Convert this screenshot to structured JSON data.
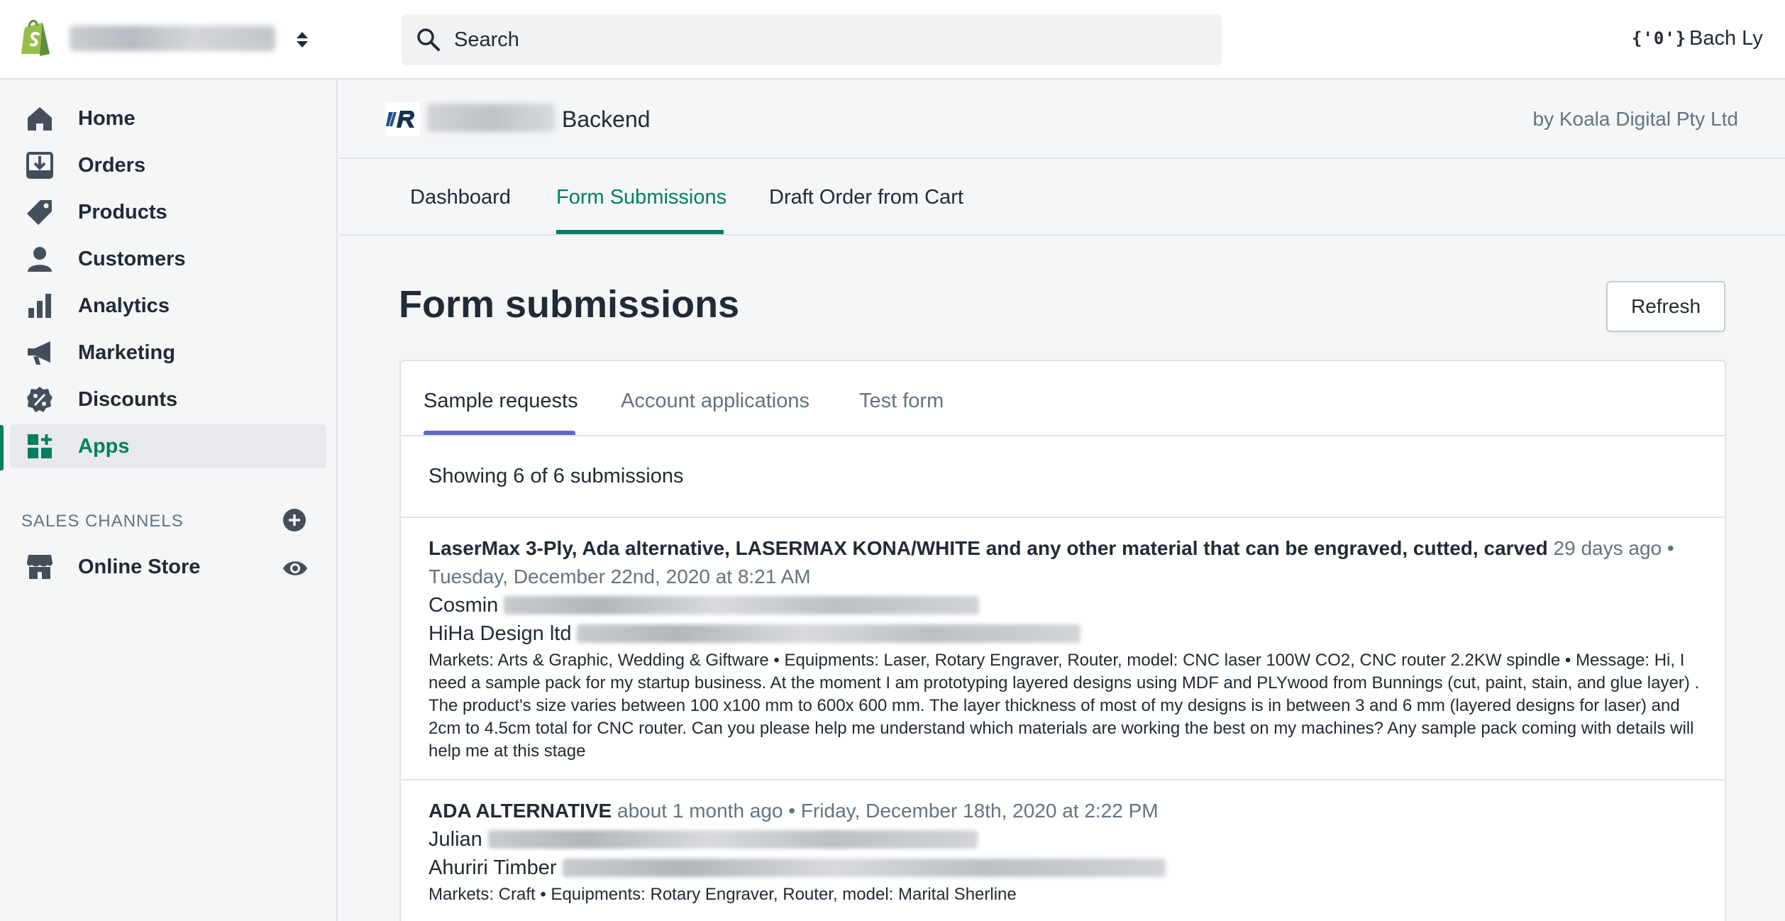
{
  "topbar": {
    "search_placeholder": "Search",
    "user_initials": "{'0'}",
    "user_name": "Bach Ly"
  },
  "sidebar": {
    "items": [
      {
        "label": "Home",
        "icon": "home-icon"
      },
      {
        "label": "Orders",
        "icon": "orders-icon"
      },
      {
        "label": "Products",
        "icon": "tag-icon"
      },
      {
        "label": "Customers",
        "icon": "person-icon"
      },
      {
        "label": "Analytics",
        "icon": "bar-chart-icon"
      },
      {
        "label": "Marketing",
        "icon": "megaphone-icon"
      },
      {
        "label": "Discounts",
        "icon": "discount-icon"
      },
      {
        "label": "Apps",
        "icon": "apps-icon"
      }
    ],
    "sales_channels_title": "SALES CHANNELS",
    "online_store_label": "Online Store"
  },
  "app_header": {
    "title": "Backend",
    "by": "by Koala Digital Pty Ltd"
  },
  "top_tabs": [
    "Dashboard",
    "Form Submissions",
    "Draft Order from Cart"
  ],
  "page": {
    "title": "Form submissions",
    "refresh_label": "Refresh"
  },
  "card": {
    "tabs": [
      "Sample requests",
      "Account applications",
      "Test form"
    ],
    "showing": "Showing 6 of 6 submissions"
  },
  "submissions": [
    {
      "title": "LaserMax 3-Ply, Ada alternative, LASERMAX KONA/WHITE and any other material that can be engraved, cutted, carved",
      "meta": "29 days ago • Tuesday, December 22nd, 2020 at 8:21 AM",
      "name": "Cosmin",
      "company": "HiHa Design ltd",
      "details": "Markets: Arts & Graphic, Wedding & Giftware • Equipments: Laser, Rotary Engraver, Router, model: CNC laser 100W CO2, CNC router 2.2KW spindle • Message: Hi, I need a sample pack for my startup business. At the moment I am prototyping layered designs using MDF and PLYwood from Bunnings (cut, paint, stain, and glue layer) . The product's size varies between 100 x100 mm to 600x 600 mm. The layer thickness of most of my designs is in between 3 and 6 mm (layered designs for laser) and 2cm to 4.5cm total for CNC router. Can you please help me understand which materials are working the best on my machines? Any sample pack coming with details will help me at this stage"
    },
    {
      "title": "ADA ALTERNATIVE",
      "meta": "about 1 month ago • Friday, December 18th, 2020 at 2:22 PM",
      "name": "Julian",
      "company": "Ahuriri Timber",
      "details": "Markets: Craft • Equipments: Rotary Engraver, Router, model: Marital Sherline"
    }
  ],
  "colors": {
    "accent_green": "#008060",
    "card_tab_indicator": "#5c6ac4",
    "shopify_green": "#95bf47"
  }
}
